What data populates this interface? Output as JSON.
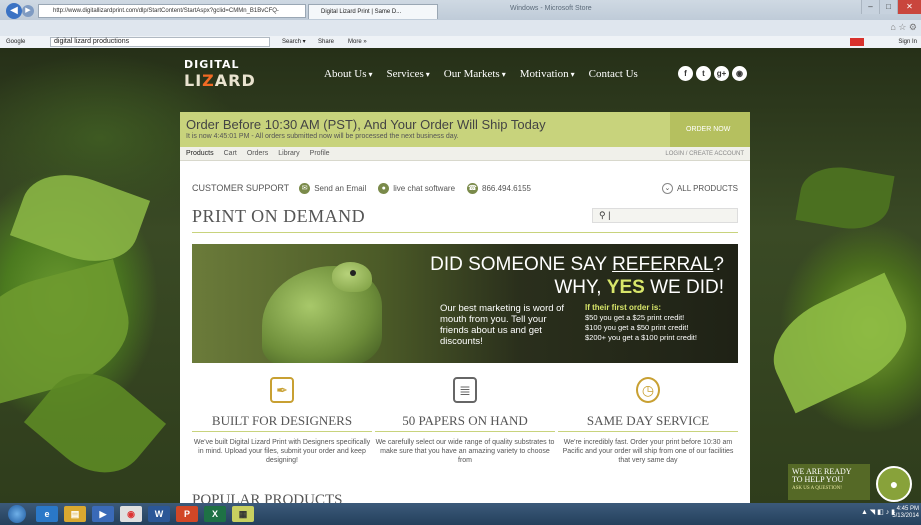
{
  "browser": {
    "address": "http://www.digitallizardprint.com/dlp/StartContent/StartAspx?gclid=CMMn_B1BvCFQ-",
    "address_suffix": "ρ ▾ C",
    "tab_title": "Digital Lizard Print | Same D...",
    "window_title": "Windows - Microsoft Store",
    "google_label": "Google",
    "google_query": "digital lizard productions",
    "search_label": "Search ▾",
    "share_label": "Share",
    "more_label": "More »",
    "sign_in": "Sign In"
  },
  "site": {
    "logo_line1": "DIGITAL",
    "logo_line2_a": "LI",
    "logo_line2_b": "Z",
    "logo_line2_c": "ARD",
    "nav": [
      "About Us",
      "Services",
      "Our Markets",
      "Motivation",
      "Contact Us"
    ],
    "social": [
      "f",
      "t",
      "g+",
      "rss"
    ]
  },
  "promo": {
    "headline": "Order Before 10:30 AM (PST), And Your Order Will Ship Today",
    "subline": "It is now 4:45:01 PM - All orders submitted now will be processed the next business day.",
    "cta": "ORDER NOW"
  },
  "subnav": {
    "items": [
      "Products",
      "Cart",
      "Orders",
      "Library",
      "Profile"
    ],
    "login": "LOGIN / CREATE ACCOUNT"
  },
  "support": {
    "label": "CUSTOMER SUPPORT",
    "email": "Send an Email",
    "chat": "live chat software",
    "phone": "866.494.6155",
    "all_products": "ALL PRODUCTS"
  },
  "page_title": "PRINT ON DEMAND",
  "search_placeholder": "",
  "banner": {
    "h1_a": "DID SOMEONE SAY ",
    "h1_b": "REFERRAL",
    "h1_c": "?",
    "h2_a": "WHY, ",
    "h2_b": "YES",
    "h2_c": " WE DID!",
    "left_text": "Our best marketing is word of mouth from you. Tell your friends about us and get discounts!",
    "right_header": "If their first order is:",
    "right_lines": [
      "$50 you get a $25 print credit!",
      "$100 you get a $50 print credit!",
      "$200+ you get a $100 print credit!"
    ]
  },
  "features": [
    {
      "title": "BUILT FOR DESIGNERS",
      "desc": "We've built Digital Lizard Print with Designers specifically in mind. Upload your files, submit your order and keep designing!",
      "icon": "pen-nib-icon"
    },
    {
      "title": "50 PAPERS ON HAND",
      "desc": "We carefully select our wide range of quality substrates to make sure that you have an amazing variety to choose from",
      "icon": "paper-stack-icon"
    },
    {
      "title": "SAME DAY SERVICE",
      "desc": "We're incredibly fast. Order your print before 10:30 am Pacific and your order will ship from one of our facilities that very same day",
      "icon": "stopwatch-icon"
    }
  ],
  "popular": "POPULAR PRODUCTS",
  "help": {
    "line1": "WE ARE READY",
    "line2": "TO HELP YOU",
    "line3": "ASK US A QUESTION!"
  },
  "taskbar": {
    "time": "4:45 PM",
    "date": "5/13/2014"
  }
}
